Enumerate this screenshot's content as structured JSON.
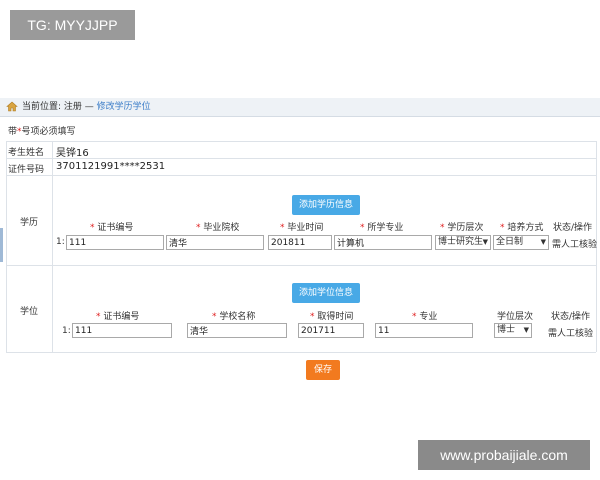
{
  "tag": "TG: MYYJJPP",
  "watermark": "www.probaijiale.com",
  "breadcrumb": {
    "prefix": "当前位置: 注册 — ",
    "current": "修改学历学位"
  },
  "required_note": {
    "prefix": "带",
    "star": "*",
    "suffix": "号项必须填写"
  },
  "info": {
    "name_label": "考生姓名",
    "name_value": "吴铧16",
    "id_label": "证件号码",
    "id_value": "3701121991****2531"
  },
  "education": {
    "section_label": "学历",
    "add_button": "添加学历信息",
    "headers": [
      "证书编号",
      "毕业院校",
      "毕业时间",
      "所学专业",
      "学历层次",
      "培养方式"
    ],
    "status_header": "状态/操作",
    "row": {
      "num": "1:",
      "cert_no": "111",
      "school": "清华",
      "grad_time": "201811",
      "major": "计算机",
      "level": "博士研究生",
      "mode": "全日制",
      "status": "需人工核验"
    }
  },
  "degree": {
    "section_label": "学位",
    "add_button": "添加学位信息",
    "headers": [
      "证书编号",
      "学校名称",
      "取得时间",
      "专业"
    ],
    "level_header": "学位层次",
    "status_header": "状态/操作",
    "row": {
      "num": "1:",
      "cert_no": "111",
      "school": "清华",
      "obtain_time": "201711",
      "major": "11",
      "level": "博士",
      "status": "需人工核验"
    }
  },
  "save_button": "保存",
  "colors": {
    "accent_blue": "#48a9e6",
    "save_orange": "#f27a1f",
    "required_red": "#e02020"
  },
  "icons": {
    "home": "home-icon",
    "caret": "chevron-down-icon"
  }
}
